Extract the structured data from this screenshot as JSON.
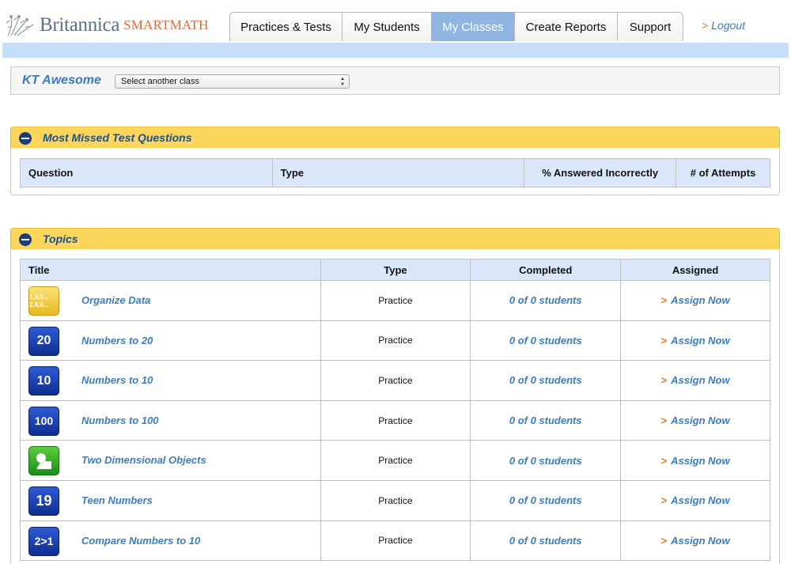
{
  "brand": {
    "name": "Britannica",
    "product": "SMARTMATH"
  },
  "nav": {
    "tabs": [
      {
        "label": "Practices & Tests"
      },
      {
        "label": "My Students"
      },
      {
        "label": "My Classes",
        "active": true
      },
      {
        "label": "Create Reports"
      },
      {
        "label": "Support"
      }
    ],
    "logout": "Logout",
    "logout_arrow": ">"
  },
  "class_bar": {
    "name": "KT Awesome",
    "select_value": "Select another class"
  },
  "missed": {
    "title": "Most Missed Test Questions",
    "columns": [
      "Question",
      "Type",
      "% Answered Incorrectly",
      "# of Attempts"
    ]
  },
  "topics": {
    "title": "Topics",
    "columns": [
      "Title",
      "Type",
      "Completed",
      "Assigned"
    ],
    "assign_arrow": ">",
    "rows": [
      {
        "icon": "data-icon",
        "icon_text": "1,3,5... 2,4,6...",
        "title": "Organize Data",
        "type": "Practice",
        "completed": "0 of 0 students",
        "assigned": "Assign Now"
      },
      {
        "icon": "number-icon",
        "icon_text": "20",
        "title": "Numbers to 20",
        "type": "Practice",
        "completed": "0 of 0 students",
        "assigned": "Assign Now"
      },
      {
        "icon": "number-icon",
        "icon_text": "10",
        "title": "Numbers to 10",
        "type": "Practice",
        "completed": "0 of 0 students",
        "assigned": "Assign Now"
      },
      {
        "icon": "number-icon",
        "icon_text": "100",
        "title": "Numbers to 100",
        "type": "Practice",
        "completed": "0 of 0 students",
        "assigned": "Assign Now"
      },
      {
        "icon": "shapes-icon",
        "icon_text": "",
        "title": "Two Dimensional Objects",
        "type": "Practice",
        "completed": "0 of 0 students",
        "assigned": "Assign Now"
      },
      {
        "icon": "number-icon",
        "icon_text": "19",
        "title": "Teen Numbers",
        "type": "Practice",
        "completed": "0 of 0 students",
        "assigned": "Assign Now"
      },
      {
        "icon": "compare-icon",
        "icon_text": "2>1",
        "title": "Compare Numbers to 10",
        "type": "Practice",
        "completed": "0 of 0 students",
        "assigned": "Assign Now"
      }
    ]
  },
  "colors": {
    "accent_blue": "#3c7cc4",
    "panel_yellow": "#fbd65a",
    "active_tab": "#8fb5e3",
    "header_bar": "#c6def8",
    "arrow_orange": "#e07b2e"
  }
}
